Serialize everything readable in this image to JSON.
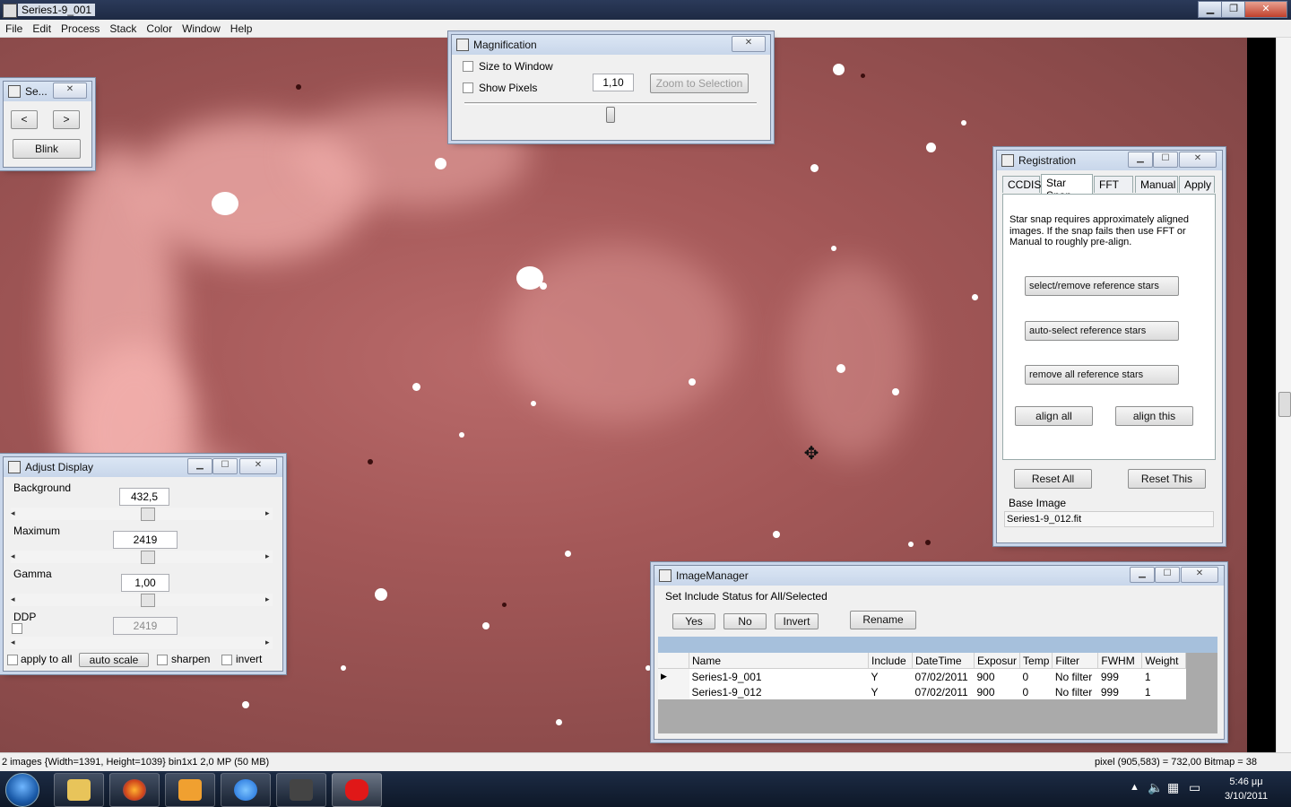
{
  "app": {
    "title": "Series1-9_001",
    "controls": {
      "minimize": "▁",
      "restore": "❐",
      "close": "✕"
    }
  },
  "menu": [
    "File",
    "Edit",
    "Process",
    "Stack",
    "Color",
    "Window",
    "Help"
  ],
  "series_window": {
    "title": "Se...",
    "prev": "<",
    "next": ">",
    "blink": "Blink"
  },
  "magnification": {
    "title": "Magnification",
    "size_to_window": "Size to Window",
    "show_pixels": "Show Pixels",
    "zoom_value": "1,10",
    "zoom_to_selection": "Zoom to Selection",
    "slider_level": 0.5
  },
  "registration": {
    "title": "Registration",
    "tabs": [
      "CCDIS",
      "Star Snap",
      "FFT",
      "Manual",
      "Apply"
    ],
    "active_tab": "Star Snap",
    "description": "Star snap requires approximately aligned images. If the snap fails then use FFT or Manual to roughly pre-align.",
    "buttons": {
      "select_remove": "select/remove reference stars",
      "auto_select": "auto-select reference stars",
      "remove_all": "remove all reference stars",
      "align_all": "align all",
      "align_this": "align this",
      "reset_all": "Reset All",
      "reset_this": "Reset This"
    },
    "base_image_label": "Base Image",
    "base_image_value": "Series1-9_012.fit"
  },
  "adjust_display": {
    "title": "Adjust Display",
    "background_label": "Background",
    "background_value": "432,5",
    "maximum_label": "Maximum",
    "maximum_value": "2419",
    "gamma_label": "Gamma",
    "gamma_value": "1,00",
    "ddp_label": "DDP",
    "ddp_value": "2419",
    "apply_to_all": "apply to all",
    "auto_scale": "auto scale",
    "sharpen": "sharpen",
    "invert": "invert"
  },
  "image_manager": {
    "title": "ImageManager",
    "include_group_label": "Set Include Status for All/Selected",
    "yes": "Yes",
    "no": "No",
    "invert": "Invert",
    "rename": "Rename",
    "columns": [
      "Name",
      "Include",
      "DateTime",
      "Exposur",
      "Temp",
      "Filter",
      "FWHM",
      "Weight"
    ],
    "rows": [
      {
        "selected": true,
        "name": "Series1-9_001",
        "include": "Y",
        "datetime": "07/02/2011",
        "exposure": "900",
        "temp": "0",
        "filter": "No filter",
        "fwhm": "999",
        "weight": "1"
      },
      {
        "selected": false,
        "name": "Series1-9_012",
        "include": "Y",
        "datetime": "07/02/2011",
        "exposure": "900",
        "temp": "0",
        "filter": "No filter",
        "fwhm": "999",
        "weight": "1"
      }
    ],
    "header_band_color": "#a6c0dc"
  },
  "status": {
    "left": "2 images  {Width=1391, Height=1039} bin1x1  2,0 MP (50 MB)",
    "right": "pixel (905,583) = 732,00  Bitmap = 38"
  },
  "taskbar": {
    "time": "5:46 μμ",
    "date": "3/10/2011",
    "apps": [
      "explorer-icon",
      "firefox-icon",
      "media-player-icon",
      "ie-icon",
      "app-icon",
      "maxim-icon"
    ]
  },
  "colors": {
    "image_tint": "#a45858",
    "accent": "#3399ff"
  }
}
